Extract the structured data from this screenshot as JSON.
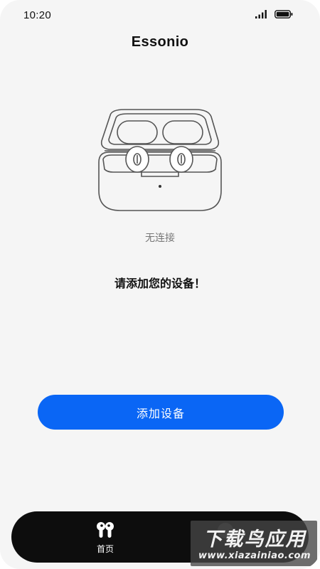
{
  "status_bar": {
    "time": "10:20",
    "signal_icon": "cellular-signal-icon",
    "battery_icon": "battery-icon"
  },
  "header": {
    "title": "Essonio"
  },
  "device": {
    "illustration_icon": "earbuds-case-icon",
    "connection_status": "无连接",
    "prompt": "请添加您的设备！"
  },
  "actions": {
    "add_device_label": "添加设备",
    "add_device_color": "#0a66f5"
  },
  "bottom_nav": {
    "items": [
      {
        "label": "首页",
        "icon": "earbuds-icon",
        "active": true
      },
      {
        "label": "",
        "icon": "circle-icon",
        "active": false
      }
    ]
  },
  "watermark": {
    "main": "下载鸟应用",
    "sub": "www.xiazainiao.com"
  }
}
